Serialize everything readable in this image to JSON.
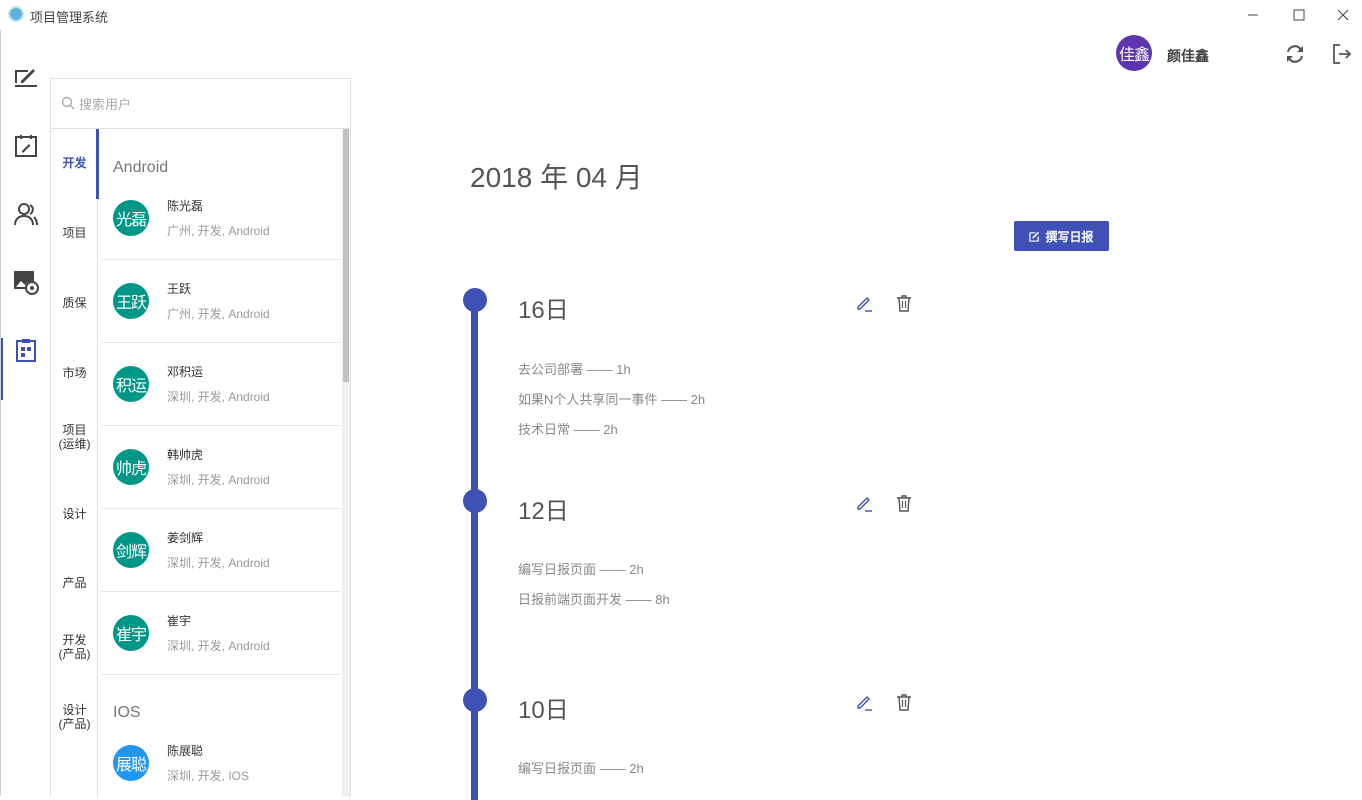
{
  "window": {
    "title": "项目管理系统"
  },
  "header": {
    "user_avatar_text": "佳鑫",
    "user_name": "颜佳鑫"
  },
  "search": {
    "placeholder": "搜索用户"
  },
  "categories": [
    "开发",
    "项目",
    "质保",
    "市场",
    "项目\n(运维)",
    "设计",
    "产品",
    "开发\n(产品)",
    "设计\n(产品)"
  ],
  "groups": [
    {
      "label": "Android",
      "users": [
        {
          "avatar": "光磊",
          "name": "陈光磊",
          "meta": "广州, 开发, Android"
        },
        {
          "avatar": "王跃",
          "name": "王跃",
          "meta": "广州, 开发, Android"
        },
        {
          "avatar": "积运",
          "name": "邓积运",
          "meta": "深圳, 开发, Android"
        },
        {
          "avatar": "帅虎",
          "name": "韩帅虎",
          "meta": "深圳, 开发, Android"
        },
        {
          "avatar": "剑辉",
          "name": "姜剑辉",
          "meta": "深圳, 开发, Android"
        },
        {
          "avatar": "崔宇",
          "name": "崔宇",
          "meta": "深圳, 开发, Android"
        }
      ]
    },
    {
      "label": "IOS",
      "users": [
        {
          "avatar": "展聪",
          "name": "陈展聪",
          "meta": "深圳, 开发, IOS"
        }
      ]
    }
  ],
  "main": {
    "month_title": "2018 年 04 月",
    "write_button": "撰写日报",
    "days": [
      {
        "day": "16日",
        "entries": [
          "去公司部署 —— 1h",
          "如果N个人共享同一事件 —— 2h",
          "技术日常 —— 2h"
        ]
      },
      {
        "day": "12日",
        "entries": [
          "编写日报页面 —— 2h",
          "日报前端页面开发 —— 8h"
        ]
      },
      {
        "day": "10日",
        "entries": [
          "编写日报页面 —— 2h"
        ]
      }
    ]
  },
  "colors": {
    "primary": "#3f51b5",
    "avatar_android": "#009688",
    "avatar_ios": "#2196f3",
    "avatar_user": "#5e35b1"
  }
}
